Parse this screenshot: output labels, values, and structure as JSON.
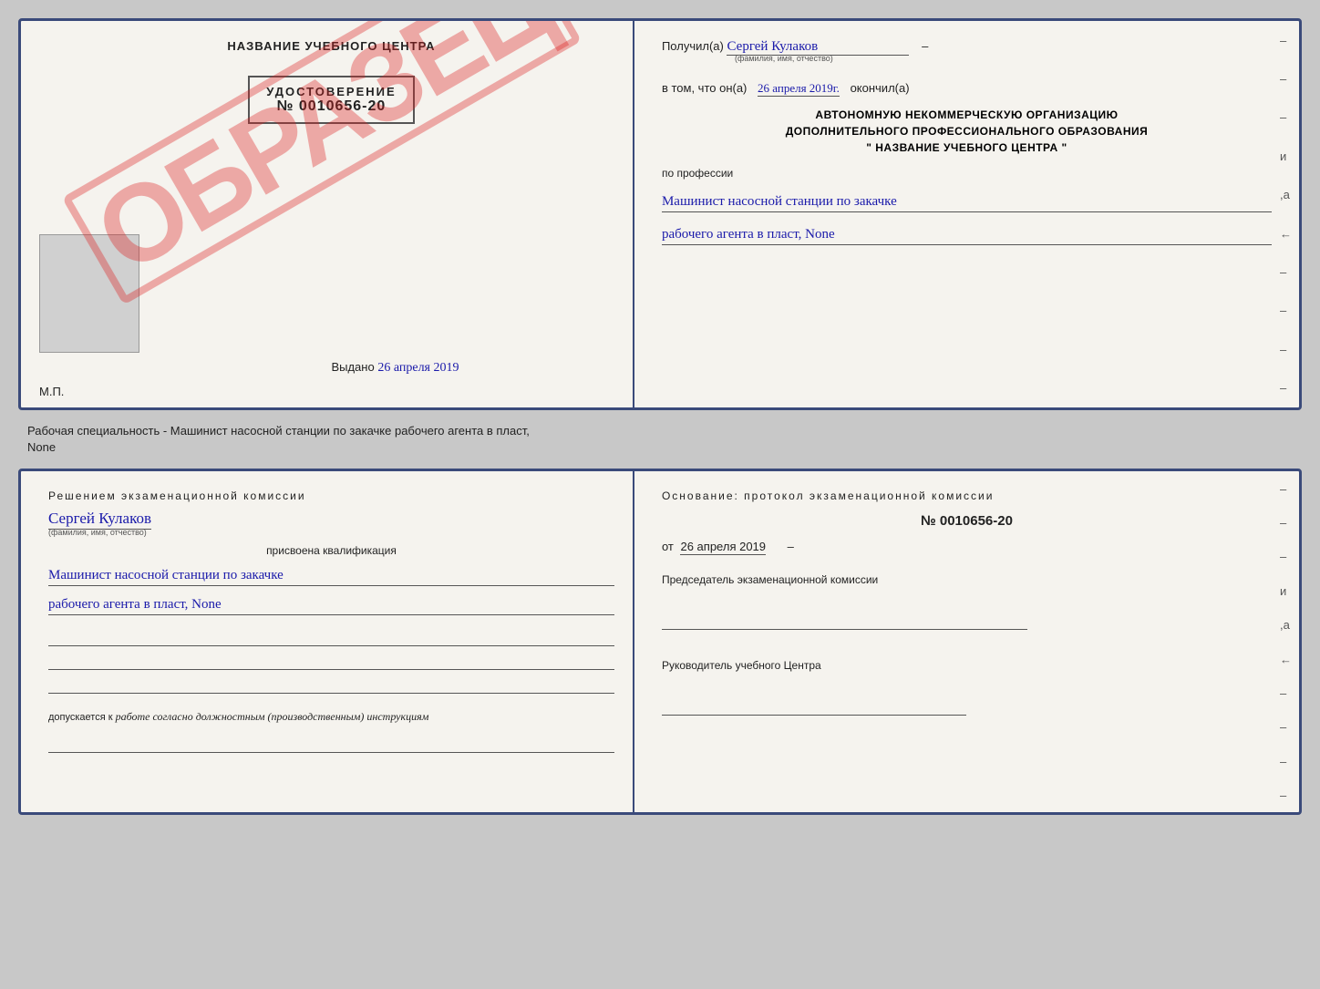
{
  "top_cert": {
    "left": {
      "title": "НАЗВАНИЕ УЧЕБНОГО ЦЕНТРА",
      "udostoverenie_label": "УДОСТОВЕРЕНИЕ",
      "number": "№ 0010656-20",
      "vydano_label": "Выдано",
      "vydano_date": "26 апреля 2019",
      "mp_label": "М.П.",
      "obrazets": "ОБРАЗЕЦ"
    },
    "right": {
      "poluchil_label": "Получил(a)",
      "poluchil_name": "Сергей Кулаков",
      "familiya_label": "(фамилия, имя, отчество)",
      "v_tom_label": "в том, что он(а)",
      "date_value": "26 апреля 2019г.",
      "okonchil_label": "окончил(а)",
      "org_line1": "АВТОНОМНУЮ НЕКОММЕРЧЕСКУЮ ОРГАНИЗАЦИЮ",
      "org_line2": "ДОПОЛНИТЕЛЬНОГО ПРОФЕССИОНАЛЬНОГО ОБРАЗОВАНИЯ",
      "org_line3": "\"  НАЗВАНИЕ УЧЕБНОГО ЦЕНТРА  \"",
      "po_professii": "по профессии",
      "profession_line1": "Машинист насосной станции по закачке",
      "profession_line2": "рабочего агента в пласт, None"
    }
  },
  "description": {
    "text_line1": "Рабочая специальность - Машинист насосной станции по закачке рабочего агента в пласт,",
    "text_line2": "None"
  },
  "bottom_cert": {
    "left": {
      "resheniem_label": "Решением экзаменационной комиссии",
      "name": "Сергей Кулаков",
      "familiya_label": "(фамилия, имя, отчество)",
      "prisvoena_label": "присвоена квалификация",
      "qualification_line1": "Машинист насосной станции по закачке",
      "qualification_line2": "рабочего агента в пласт, None",
      "line1": "",
      "line2": "",
      "line3": "",
      "dopuskaetsya_label": "допускается к",
      "dopuskaetsya_value": "работе согласно должностным (производственным) инструкциям",
      "bottom_line": ""
    },
    "right": {
      "osnovanie_label": "Основание: протокол экзаменационной комиссии",
      "protocol_num": "№ 0010656-20",
      "ot_label": "от",
      "ot_date": "26 апреля 2019",
      "predsedatel_label": "Председатель экзаменационной комиссии",
      "rukovoditel_label": "Руководитель учебного Центра"
    }
  }
}
